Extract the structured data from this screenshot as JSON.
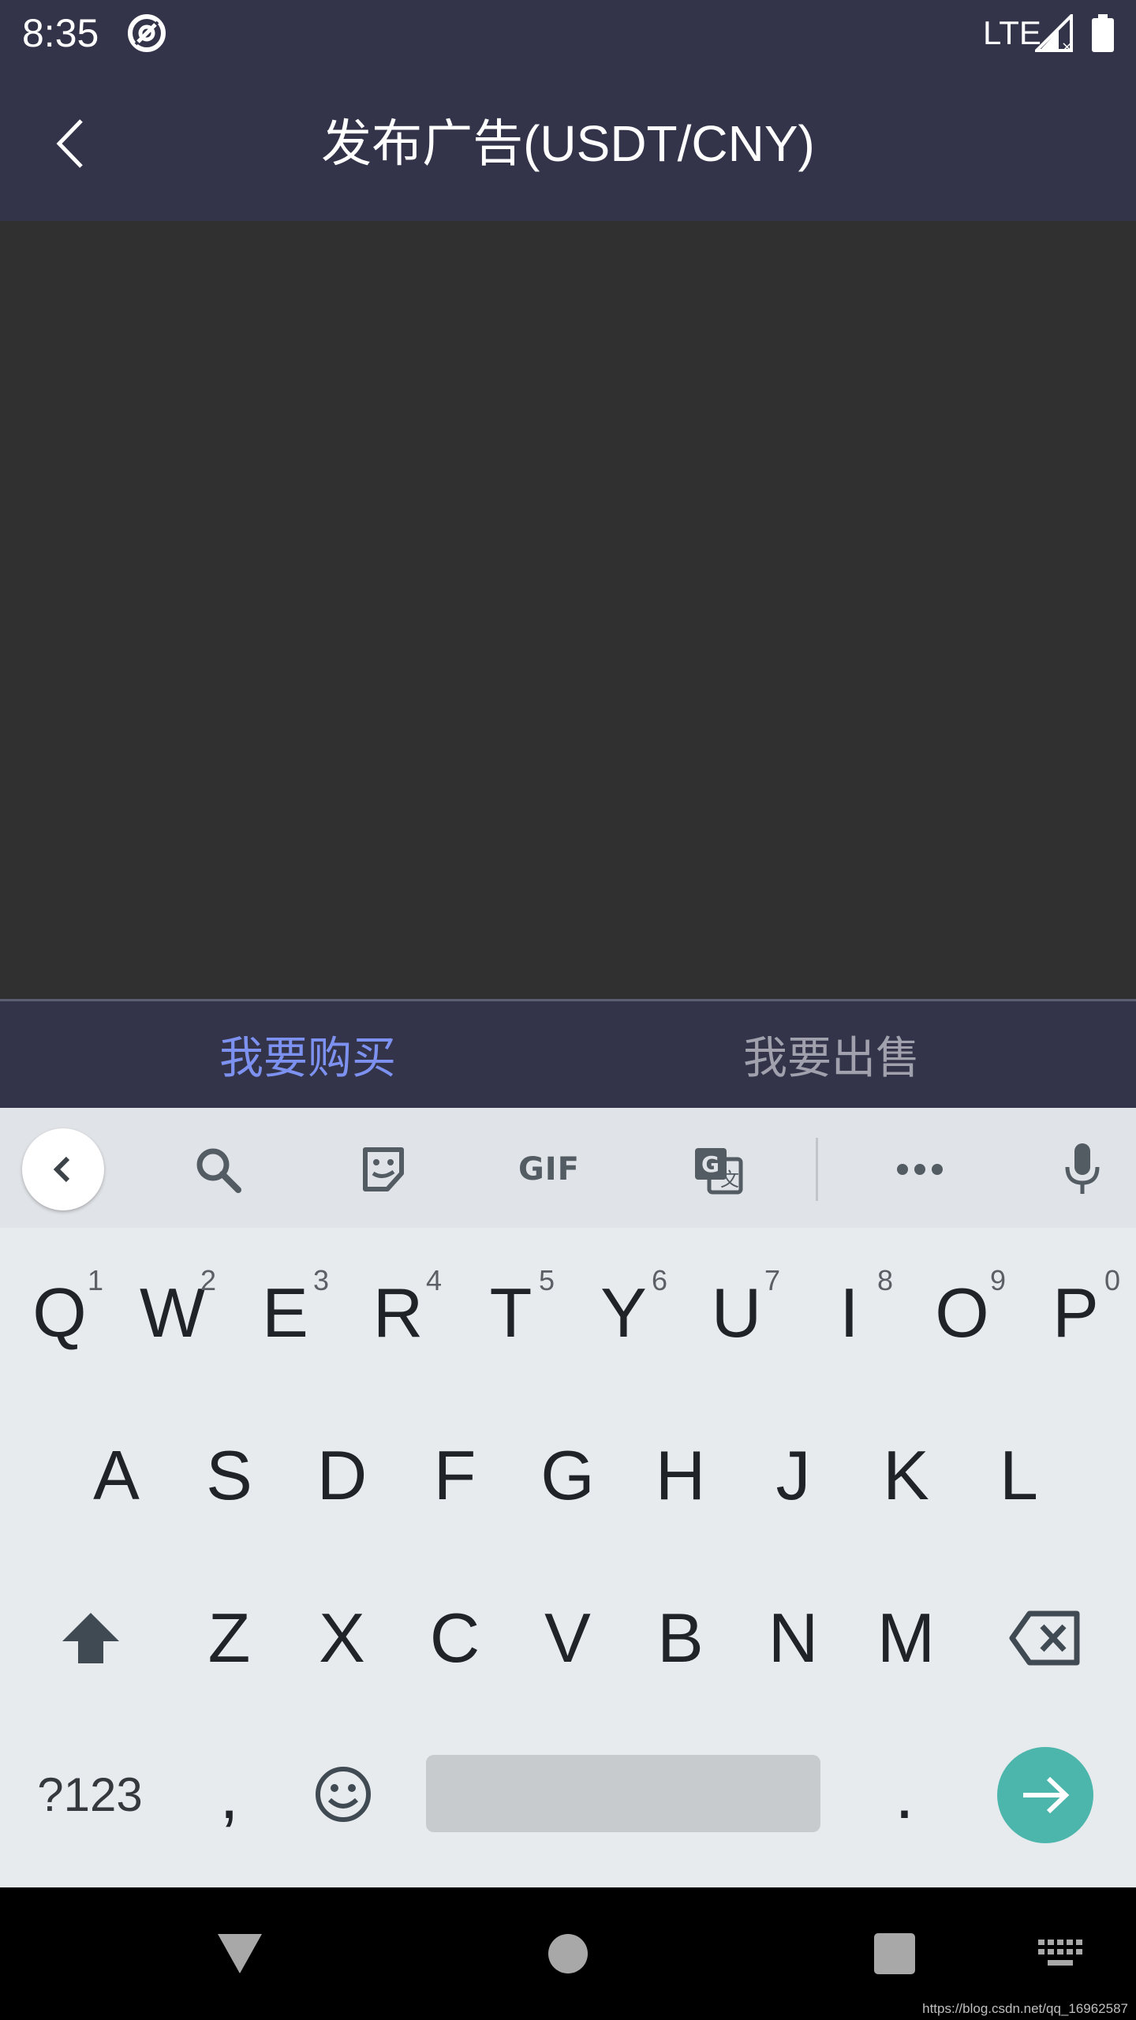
{
  "status_bar": {
    "time": "8:35",
    "network": "LTE",
    "sync_icon": "sync-at-icon",
    "signal_icon": "signal-no-data-icon",
    "battery_icon": "battery-full-icon"
  },
  "app_bar": {
    "title": "发布广告(USDT/CNY)",
    "back_icon": "chevron-left-icon"
  },
  "tabs": [
    {
      "label": "我要购买",
      "active": true
    },
    {
      "label": "我要出售",
      "active": false
    }
  ],
  "keyboard": {
    "toolbar": {
      "collapse_icon": "chevron-left-icon",
      "search_icon": "search-icon",
      "sticker_icon": "sticker-icon",
      "gif_label": "GIF",
      "translate_icon": "translate-icon",
      "more_icon": "more-horizontal-icon",
      "mic_icon": "microphone-icon"
    },
    "row1": [
      {
        "label": "Q",
        "hint": "1"
      },
      {
        "label": "W",
        "hint": "2"
      },
      {
        "label": "E",
        "hint": "3"
      },
      {
        "label": "R",
        "hint": "4"
      },
      {
        "label": "T",
        "hint": "5"
      },
      {
        "label": "Y",
        "hint": "6"
      },
      {
        "label": "U",
        "hint": "7"
      },
      {
        "label": "I",
        "hint": "8"
      },
      {
        "label": "O",
        "hint": "9"
      },
      {
        "label": "P",
        "hint": "0"
      }
    ],
    "row2": [
      "A",
      "S",
      "D",
      "F",
      "G",
      "H",
      "J",
      "K",
      "L"
    ],
    "row3": [
      "Z",
      "X",
      "C",
      "V",
      "B",
      "N",
      "M"
    ],
    "row4": {
      "symbols_label": "?123",
      "comma_label": ",",
      "emoji_icon": "emoji-icon",
      "period_label": ".",
      "enter_icon": "arrow-right-icon"
    },
    "shift_icon": "shift-icon",
    "backspace_icon": "backspace-icon"
  },
  "nav_bar": {
    "back_icon": "nav-back-triangle-icon",
    "home_icon": "nav-home-circle-icon",
    "recents_icon": "nav-recents-square-icon",
    "keyboard_switch_icon": "keyboard-icon"
  },
  "watermark": "https://blog.csdn.net/qq_16962587",
  "colors": {
    "header_bg": "#33344a",
    "content_bg": "#303030",
    "active_tab": "#7d92f0",
    "inactive_tab": "#a0a1ad",
    "keyboard_bg": "#e8ebee",
    "enter_key": "#4db6ac"
  }
}
